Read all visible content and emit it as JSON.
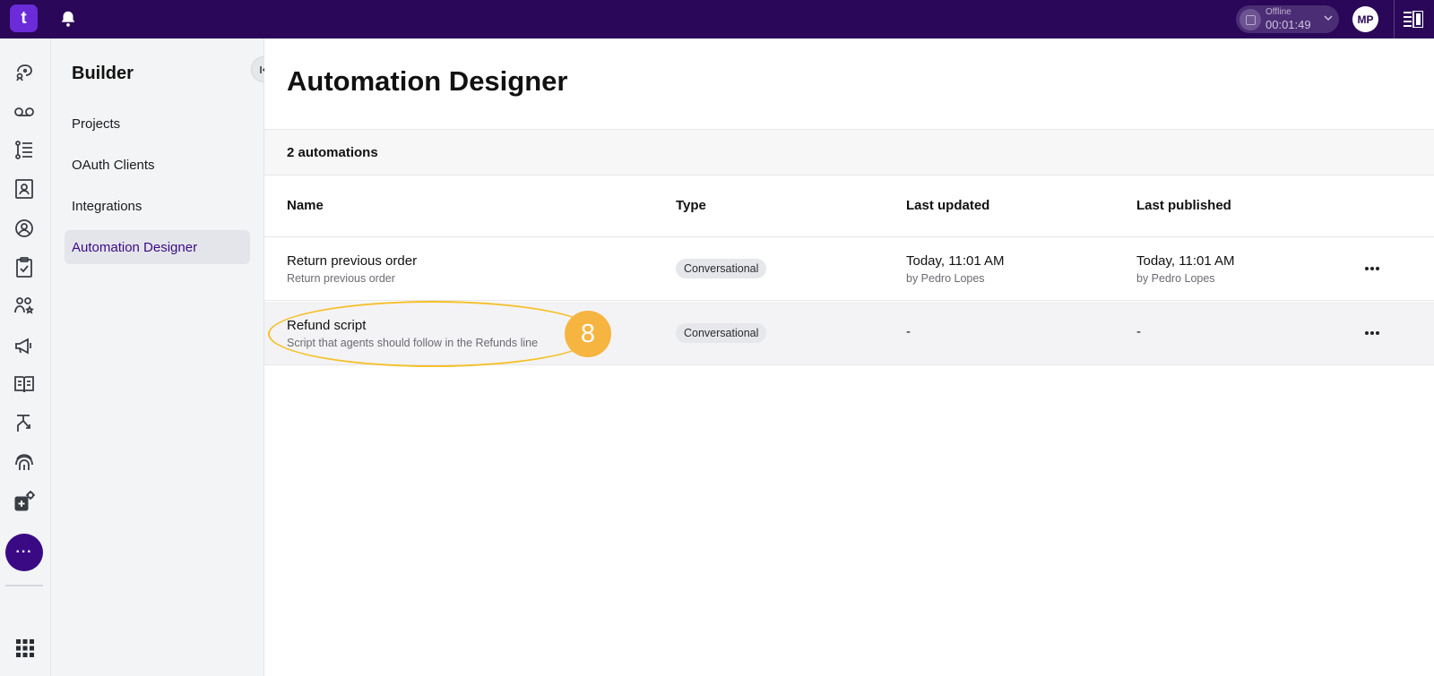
{
  "topbar": {
    "logo_text": "t",
    "status": {
      "label": "Offline",
      "timer": "00:01:49"
    },
    "avatar_initials": "MP"
  },
  "rail": {
    "icons": [
      "conversations-icon",
      "voicemail-icon",
      "queue-list-icon",
      "contacts-icon",
      "agent-icon",
      "tasks-icon",
      "team-icon",
      "campaign-icon",
      "knowledge-icon",
      "routing-icon",
      "fingerprint-icon",
      "integrations-settings-icon"
    ],
    "more_label": "···"
  },
  "sidebar": {
    "title": "Builder",
    "items": [
      {
        "label": "Projects"
      },
      {
        "label": "OAuth Clients"
      },
      {
        "label": "Integrations"
      },
      {
        "label": "Automation Designer"
      }
    ]
  },
  "main": {
    "title": "Automation Designer",
    "count": "2 automations",
    "columns": [
      "Name",
      "Type",
      "Last updated",
      "Last published"
    ],
    "rows": [
      {
        "name": "Return previous order",
        "description": "Return previous order",
        "type": "Conversational",
        "updated_date": "Today, 11:01 AM",
        "updated_by": "by Pedro Lopes",
        "published_date": "Today, 11:01 AM",
        "published_by": "by Pedro Lopes"
      },
      {
        "name": "Refund script",
        "description": "Script that agents should follow in the Refunds line",
        "type": "Conversational",
        "updated_date": "-",
        "published_date": "-"
      }
    ]
  },
  "annotation": {
    "number": "8",
    "color": "#f6b440"
  }
}
